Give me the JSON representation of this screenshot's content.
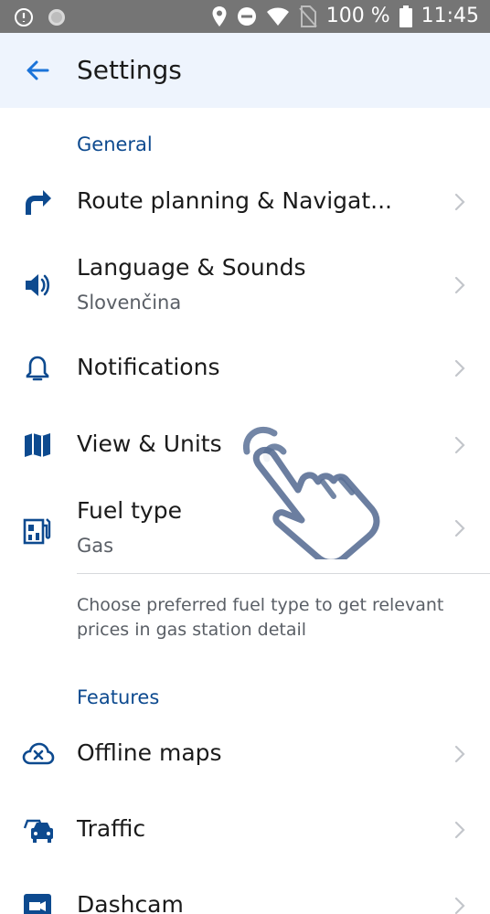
{
  "status_bar": {
    "battery_text": "100 %",
    "time": "11:45",
    "icons": [
      "alarm-icon",
      "sync-icon",
      "location-icon",
      "do-not-disturb-icon",
      "wifi-icon",
      "no-sim-icon",
      "battery-icon"
    ]
  },
  "app_bar": {
    "title": "Settings",
    "back_icon": "arrow-back-icon"
  },
  "sections": {
    "general": "General",
    "features": "Features"
  },
  "items": {
    "route": {
      "label": "Route planning & Navigat...",
      "icon": "turn-right-arrow-icon"
    },
    "language": {
      "label": "Language & Sounds",
      "sub": "Slovenčina",
      "icon": "speaker-icon"
    },
    "notifications": {
      "label": "Notifications",
      "icon": "bell-icon"
    },
    "view_units": {
      "label": "View & Units",
      "icon": "map-icon"
    },
    "fuel": {
      "label": "Fuel type",
      "sub": "Gas",
      "icon": "fuel-station-icon"
    },
    "offline": {
      "label": "Offline maps",
      "icon": "cloud-off-icon"
    },
    "traffic": {
      "label": "Traffic",
      "icon": "cars-icon"
    },
    "dashcam": {
      "label": "Dashcam",
      "icon": "video-camera-icon"
    }
  },
  "fuel_note": "Choose preferred fuel type to get relevant prices in gas station detail",
  "colors": {
    "accent": "#0d4a8f",
    "app_bar_bg": "#eef4fd",
    "status_bar_bg": "#757575",
    "chevron": "#c3c6cb"
  },
  "overlay": {
    "icon": "tap-hand-icon"
  }
}
